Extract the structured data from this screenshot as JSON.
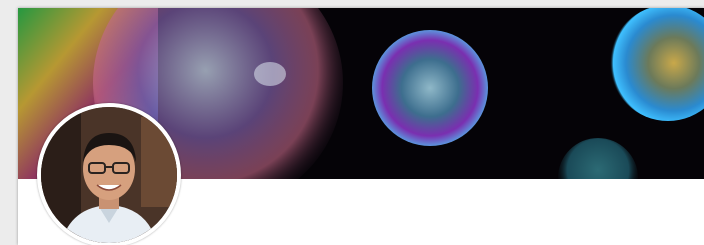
{
  "profile": {
    "cover_image": "soap-bubbles-photo",
    "avatar_image": "profile-photo-smiling-man-glasses"
  },
  "colors": {
    "cover_background": "#050307",
    "card_background": "#ffffff",
    "page_background": "#ececec"
  }
}
